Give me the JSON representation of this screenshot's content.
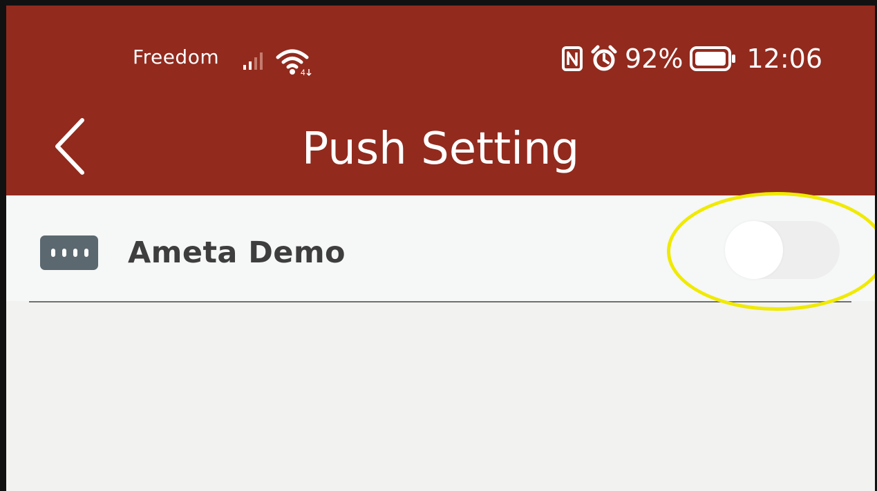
{
  "status_bar": {
    "carrier": "Freedom",
    "battery": "92%",
    "time": "12:06",
    "signal_icon": "signal-bars-icon",
    "wifi_icon": "wifi-icon",
    "nfc_icon": "nfc-icon",
    "alarm_icon": "alarm-icon",
    "battery_icon": "battery-icon"
  },
  "header": {
    "title": "Push Setting",
    "back_icon": "chevron-left-icon",
    "background_color": "#922a1e"
  },
  "devices": [
    {
      "name": "Ameta Demo",
      "icon": "device-icon",
      "push_enabled": false
    }
  ],
  "annotation": {
    "highlight_color": "#f0ea00",
    "target": "push-toggle"
  }
}
